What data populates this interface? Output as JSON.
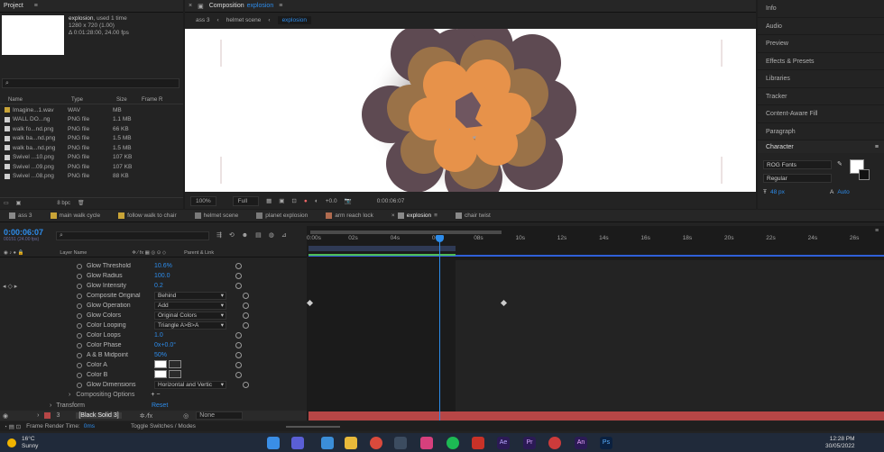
{
  "project": {
    "title": "Project",
    "item_name": "explosion",
    "item_used": ", used 1 time",
    "item_size": "1280 x 720 (1.00)",
    "item_duration": "Δ 0:01:28:00, 24.00 fps",
    "search_placeholder": "",
    "columns": [
      "Name",
      "Type",
      "Size",
      "Frame R"
    ],
    "files": [
      {
        "name": "Imagine...1.wav",
        "type": "WAV",
        "size": "MB",
        "color": "#c9a437"
      },
      {
        "name": "WALL DO...ng",
        "type": "PNG file",
        "size": "1.1 MB",
        "color": "#cfcfcf"
      },
      {
        "name": "walk fo...nd.png",
        "type": "PNG file",
        "size": "66 KB",
        "color": "#cfcfcf"
      },
      {
        "name": "walk ba...nd.png",
        "type": "PNG file",
        "size": "1.5 MB",
        "color": "#cfcfcf"
      },
      {
        "name": "walk ba...nd.png",
        "type": "PNG file",
        "size": "1.5 MB",
        "color": "#cfcfcf"
      },
      {
        "name": "Swivel ...10.png",
        "type": "PNG file",
        "size": "107 KB",
        "color": "#cfcfcf"
      },
      {
        "name": "Swivel ...09.png",
        "type": "PNG file",
        "size": "107 KB",
        "color": "#cfcfcf"
      },
      {
        "name": "Swivel ...08.png",
        "type": "PNG file",
        "size": "88 KB",
        "color": "#cfcfcf"
      }
    ],
    "bpc": "8 bpc"
  },
  "composition": {
    "panel_title": "Composition",
    "panel_name": "explosion",
    "breadcrumbs": [
      "ass 3",
      "helmet scene",
      "explosion"
    ],
    "zoom": "100%",
    "resolution": "Full",
    "timecode": "0:00:06:07"
  },
  "right_panel": {
    "items": [
      "Info",
      "Audio",
      "Preview",
      "Effects & Presets",
      "Libraries",
      "Tracker",
      "Content-Aware Fill",
      "Paragraph"
    ],
    "character": {
      "title": "Character",
      "font": "ROG Fonts",
      "style": "Regular",
      "size": "48 px",
      "leading": "Auto"
    }
  },
  "timeline": {
    "tabs": [
      "ass 3",
      "main walk cycle",
      "follow walk to chair",
      "helmet scene",
      "planet explosion",
      "arm reach lock",
      "explosion",
      "chair twist"
    ],
    "tab_colors": [
      "#8a8a8a",
      "#c9a437",
      "#c9a437",
      "#7a7a7a",
      "#7a7a7a",
      "#b06b4f",
      "#8a8a8a",
      "#8a8a8a"
    ],
    "active_tab": "explosion",
    "timecode": "0:00:06:07",
    "timecode_sub": "00151 (24.00 fps)",
    "col_layer_name": "Layer Name",
    "col_parent": "Parent & Link",
    "properties": [
      {
        "name": "Glow Threshold",
        "value": "10.6%",
        "kind": "value"
      },
      {
        "name": "Glow Radius",
        "value": "100.0",
        "kind": "value"
      },
      {
        "name": "Glow Intensity",
        "value": "0.2",
        "kind": "value",
        "keyframed": true
      },
      {
        "name": "Composite Original",
        "value": "Behind",
        "kind": "dropdown"
      },
      {
        "name": "Glow Operation",
        "value": "Add",
        "kind": "dropdown"
      },
      {
        "name": "Glow Colors",
        "value": "Original Colors",
        "kind": "dropdown"
      },
      {
        "name": "Color Looping",
        "value": "Triangle A>B>A",
        "kind": "dropdown"
      },
      {
        "name": "Color Loops",
        "value": "1.0",
        "kind": "value"
      },
      {
        "name": "Color Phase",
        "value": "0x+0.0°",
        "kind": "value"
      },
      {
        "name": "A & B Midpoint",
        "value": "50%",
        "kind": "value"
      },
      {
        "name": "Color A",
        "value": "",
        "kind": "color"
      },
      {
        "name": "Color B",
        "value": "",
        "kind": "color"
      },
      {
        "name": "Glow Dimensions",
        "value": "Horizontal and Vertic",
        "kind": "dropdown"
      }
    ],
    "compositing": "Compositing Options",
    "transform": "Transform",
    "transform_reset": "Reset",
    "layer_num": "3",
    "layer_name": "[Black Solid 3]",
    "layer_parent": "None",
    "frame_render": "Frame Render Time:",
    "frame_render_val": "0ms",
    "toggle": "Toggle Switches / Modes",
    "ruler": [
      "0:00s",
      "02s",
      "04s",
      "06s",
      "08s",
      "10s",
      "12s",
      "14s",
      "16s",
      "18s",
      "20s",
      "22s",
      "24s",
      "26s"
    ]
  },
  "taskbar": {
    "temp": "16°C",
    "weather": "Sunny",
    "time": "12:28 PM",
    "date": "30/05/2022"
  },
  "colors": {
    "accent": "#2d8ceb",
    "layer_red": "#b74646",
    "explosion_orange": "#e7924a"
  }
}
